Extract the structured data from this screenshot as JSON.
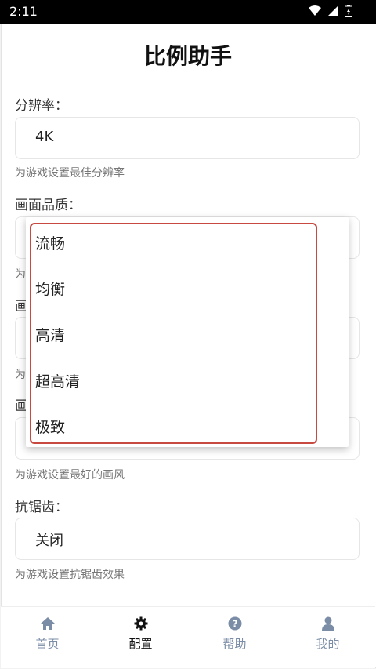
{
  "status_bar": {
    "time": "2:11"
  },
  "page": {
    "title": "比例助手"
  },
  "settings": [
    {
      "label": "分辨率：",
      "value": "4K",
      "hint": "为游戏设置最佳分辨率"
    },
    {
      "label": "画面品质：",
      "value": "",
      "hint": "为"
    },
    {
      "label": "画",
      "value": "",
      "hint": "为"
    },
    {
      "label": "画",
      "value": "",
      "hint": "为游戏设置最好的画风"
    },
    {
      "label": "抗锯齿：",
      "value": "关闭",
      "hint": "为游戏设置抗锯齿效果"
    }
  ],
  "dropdown": {
    "options": [
      "流畅",
      "均衡",
      "高清",
      "超高清",
      "极致"
    ]
  },
  "bottom_nav": {
    "items": [
      {
        "label": "首页",
        "icon": "home-icon"
      },
      {
        "label": "配置",
        "icon": "gear-icon"
      },
      {
        "label": "帮助",
        "icon": "help-icon"
      },
      {
        "label": "我的",
        "icon": "user-icon"
      }
    ],
    "active_index": 1
  },
  "colors": {
    "highlight": "#c8493f",
    "nav_inactive": "#7a8ca6",
    "nav_active": "#111111"
  }
}
